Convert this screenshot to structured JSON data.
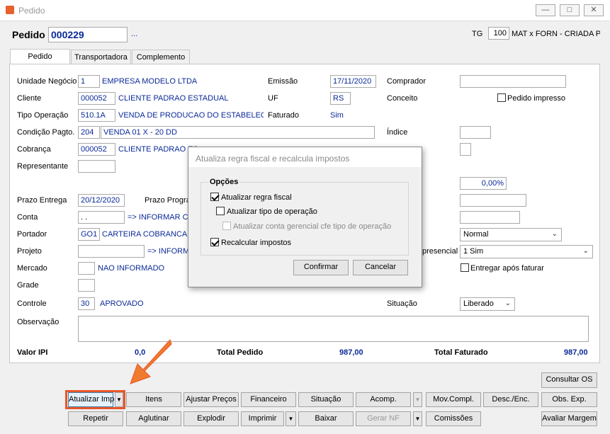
{
  "window": {
    "title": "Pedido"
  },
  "header": {
    "pedido_label": "Pedido",
    "pedido_value": "000229",
    "pedido_lookup": "...",
    "tg_label": "TG",
    "tg_value": "100",
    "tg_desc": "MAT x FORN - CRIADA PE"
  },
  "tabs": [
    "Pedido",
    "Transportadora",
    "Complemento"
  ],
  "form": {
    "unidade_label": "Unidade Negócio",
    "unidade_code": "1",
    "unidade_desc": "EMPRESA MODELO LTDA",
    "emissao_label": "Emissão",
    "emissao_value": "17/11/2020",
    "comprador_label": "Comprador",
    "comprador_value": "",
    "cliente_label": "Cliente",
    "cliente_code": "000052",
    "cliente_desc": "CLIENTE PADRAO ESTADUAL",
    "uf_label": "UF",
    "uf_value": "RS",
    "conceito_label": "Conceito",
    "pedido_impresso_label": "Pedido impresso",
    "tipo_op_label": "Tipo Operação",
    "tipo_op_code": "510.1A",
    "tipo_op_desc": "VENDA DE PRODUCAO DO ESTABELECIMEI",
    "faturado_label": "Faturado",
    "faturado_value": "Sim",
    "cond_pagto_label": "Condição Pagto.",
    "cond_pagto_code": "204",
    "cond_pagto_desc": "VENDA 01 X - 20 DD",
    "indice_label": "Índice",
    "cobranca_label": "Cobrança",
    "cobranca_code": "000052",
    "cobranca_desc": "CLIENTE PADRAO ES",
    "representante_label": "Representante",
    "percent_value": "0,00%",
    "prazo_entrega_label": "Prazo Entrega",
    "prazo_entrega_value": "20/12/2020",
    "prazo_prog_label": "Prazo Progra",
    "conta_label": "Conta",
    "conta_value": ". .",
    "conta_desc": "=> INFORMAR CO",
    "portador_label": "Portador",
    "portador_code": "GO1",
    "portador_desc": "CARTEIRA COBRANCA",
    "normal_value": "Normal",
    "projeto_label": "Projeto",
    "projeto_desc": "=> INFORM",
    "presencial_label": "presencial",
    "presencial_value": "1 Sim",
    "mercado_label": "Mercado",
    "mercado_desc": "NAO INFORMADO",
    "entregar_label": "Entregar após faturar",
    "grade_label": "Grade",
    "controle_label": "Controle",
    "controle_code": "30",
    "controle_desc": "APROVADO",
    "situacao_label": "Situação",
    "situacao_value": "Liberado",
    "observacao_label": "Observação"
  },
  "totals": {
    "valor_ipi_label": "Valor IPI",
    "valor_ipi_value": "0,0",
    "total_pedido_label": "Total Pedido",
    "total_pedido_value": "987,00",
    "total_faturado_label": "Total Faturado",
    "total_faturado_value": "987,00"
  },
  "dialog": {
    "title": "Atualiza regra fiscal e recalcula impostos",
    "group_label": "Opções",
    "opt1": "Atualizar regra fiscal",
    "opt2": "Atualizar tipo de operação",
    "opt3": "Atualizar conta gerencial cfe tipo de operação",
    "opt4": "Recalcular impostos",
    "confirm": "Confirmar",
    "cancel": "Cancelar",
    "checked": {
      "opt1": true,
      "opt2": false,
      "opt3": false,
      "opt4": true
    }
  },
  "buttons": {
    "consultar_os": "Consultar OS",
    "row1": [
      "Atualizar Imp",
      "Itens",
      "Ajustar Preços",
      "Financeiro",
      "Situação",
      "Acomp.",
      "Mov.Compl.",
      "Desc./Enc.",
      "Obs. Exp."
    ],
    "row2": [
      "Repetir",
      "Aglutinar",
      "Explodir",
      "Imprimir",
      "Baixar",
      "Gerar NF",
      "Comissões",
      "Avaliar Margem"
    ]
  },
  "colors": {
    "field_text": "#0b2a99",
    "highlight": "#e8572a"
  }
}
